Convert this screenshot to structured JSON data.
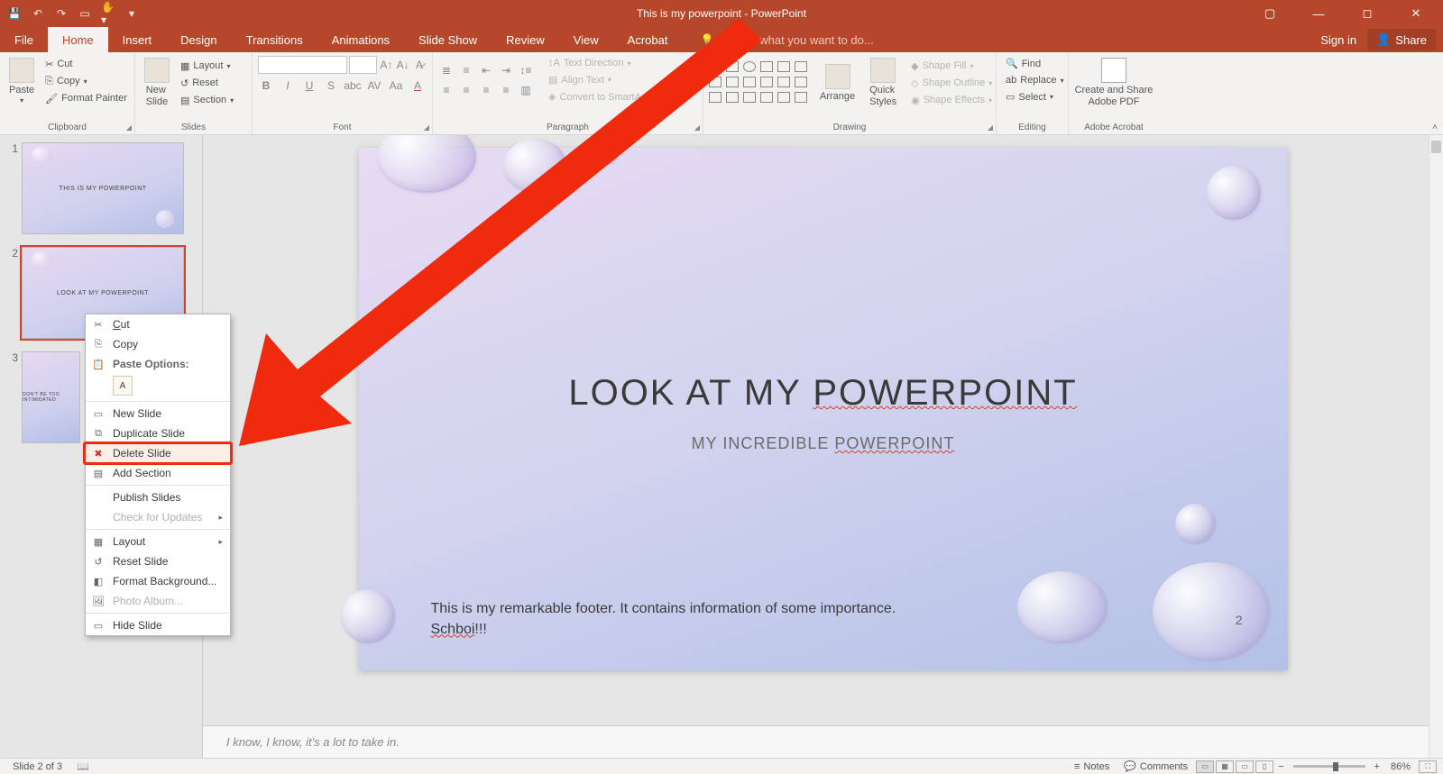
{
  "titlebar": {
    "title": "This is my powerpoint - PowerPoint"
  },
  "tabs": {
    "file": "File",
    "home": "Home",
    "insert": "Insert",
    "design": "Design",
    "transitions": "Transitions",
    "animations": "Animations",
    "slideshow": "Slide Show",
    "review": "Review",
    "view": "View",
    "acrobat": "Acrobat",
    "tellme": "Tell me what you want to do...",
    "signin": "Sign in",
    "share": "Share"
  },
  "ribbon": {
    "clipboard": {
      "label": "Clipboard",
      "paste": "Paste",
      "cut": "Cut",
      "copy": "Copy",
      "format_painter": "Format Painter"
    },
    "slides": {
      "label": "Slides",
      "new_slide": "New\nSlide",
      "layout": "Layout",
      "reset": "Reset",
      "section": "Section"
    },
    "font": {
      "label": "Font"
    },
    "paragraph": {
      "label": "Paragraph",
      "text_direction": "Text Direction",
      "align_text": "Align Text",
      "smartart": "Convert to SmartArt"
    },
    "drawing": {
      "label": "Drawing",
      "arrange": "Arrange",
      "quick_styles": "Quick\nStyles",
      "shape_fill": "Shape Fill",
      "shape_outline": "Shape Outline",
      "shape_effects": "Shape Effects"
    },
    "editing": {
      "label": "Editing",
      "find": "Find",
      "replace": "Replace",
      "select": "Select"
    },
    "adobe": {
      "label": "Adobe Acrobat",
      "create_share": "Create and Share\nAdobe PDF"
    }
  },
  "thumbs": [
    {
      "num": "1",
      "title": "THIS IS MY POWERPOINT"
    },
    {
      "num": "2",
      "title": "LOOK AT MY POWERPOINT"
    },
    {
      "num": "3",
      "title": "DON'T BE TOO INTIMIDATED"
    }
  ],
  "slide": {
    "title_plain": "LOOK AT MY ",
    "title_uline": "POWERPOINT",
    "sub_plain": "MY INCREDIBLE ",
    "sub_uline": "POWERPOINT",
    "footer_a": "This is my remarkable footer. It contains information of some importance. ",
    "footer_uline": "Schboi",
    "footer_b": "!!!",
    "pagenum": "2"
  },
  "notes": {
    "placeholder": "I know, I know, it's a lot to take in."
  },
  "ctx": {
    "cut": "Cut",
    "copy": "Copy",
    "paste_options": "Paste Options:",
    "paste_a": "A",
    "new_slide": "New Slide",
    "duplicate": "Duplicate Slide",
    "delete": "Delete Slide",
    "add_section": "Add Section",
    "publish": "Publish Slides",
    "check_updates": "Check for Updates",
    "layout": "Layout",
    "reset": "Reset Slide",
    "format_bg": "Format Background...",
    "photo_album": "Photo Album...",
    "hide": "Hide Slide"
  },
  "status": {
    "slide_of": "Slide 2 of 3",
    "notes": "Notes",
    "comments": "Comments",
    "zoom": "86%"
  }
}
